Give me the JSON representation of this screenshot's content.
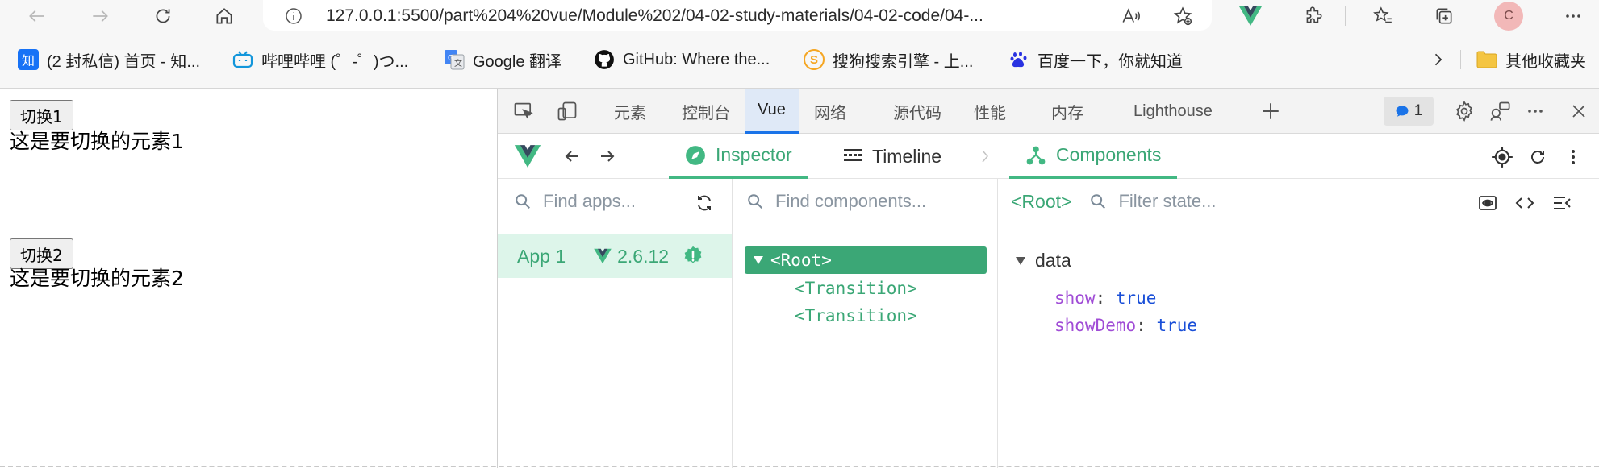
{
  "browser": {
    "address_info_icon": "info-icon",
    "url": "127.0.0.1:5500/part%204%20vue/Module%202/04-02-study-materials/04-02-code/04-...",
    "profile_initial": "C"
  },
  "bookmarks": [
    {
      "icon": "zhihu-icon",
      "label": "(2 封私信) 首页 - 知..."
    },
    {
      "icon": "bilibili-icon",
      "label": "哔哩哔哩 (゜-゜)つ..."
    },
    {
      "icon": "google-translate-icon",
      "label": "Google 翻译"
    },
    {
      "icon": "github-icon",
      "label": "GitHub: Where the..."
    },
    {
      "icon": "sogou-icon",
      "label": "搜狗搜索引擎 - 上..."
    },
    {
      "icon": "baidu-icon",
      "label": "百度一下，你就知道"
    }
  ],
  "bookmarks_folder": "其他收藏夹",
  "page": {
    "button1": "切换1",
    "text1": "这是要切换的元素1",
    "button2": "切换2",
    "text2": "这是要切换的元素2"
  },
  "devtools": {
    "tabs": [
      "元素",
      "控制台",
      "Vue",
      "网络",
      "源代码",
      "性能",
      "内存",
      "Lighthouse"
    ],
    "active_tab": "Vue",
    "issues_count": "1",
    "vue": {
      "inspector_label": "Inspector",
      "timeline_label": "Timeline",
      "components_label": "Components",
      "find_apps_placeholder": "Find apps...",
      "find_components_placeholder": "Find components...",
      "root_tag": "<Root>",
      "filter_state_placeholder": "Filter state...",
      "app_name": "App 1",
      "vue_version": "2.6.12",
      "tree": {
        "root": "<Root>",
        "children": [
          "<Transition>",
          "<Transition>"
        ]
      },
      "state": {
        "section": "data",
        "entries": [
          {
            "key": "show",
            "value": "true"
          },
          {
            "key": "showDemo",
            "value": "true"
          }
        ]
      }
    }
  },
  "colors": {
    "vue_green": "#42b883",
    "active_blue": "#1a73e8"
  }
}
